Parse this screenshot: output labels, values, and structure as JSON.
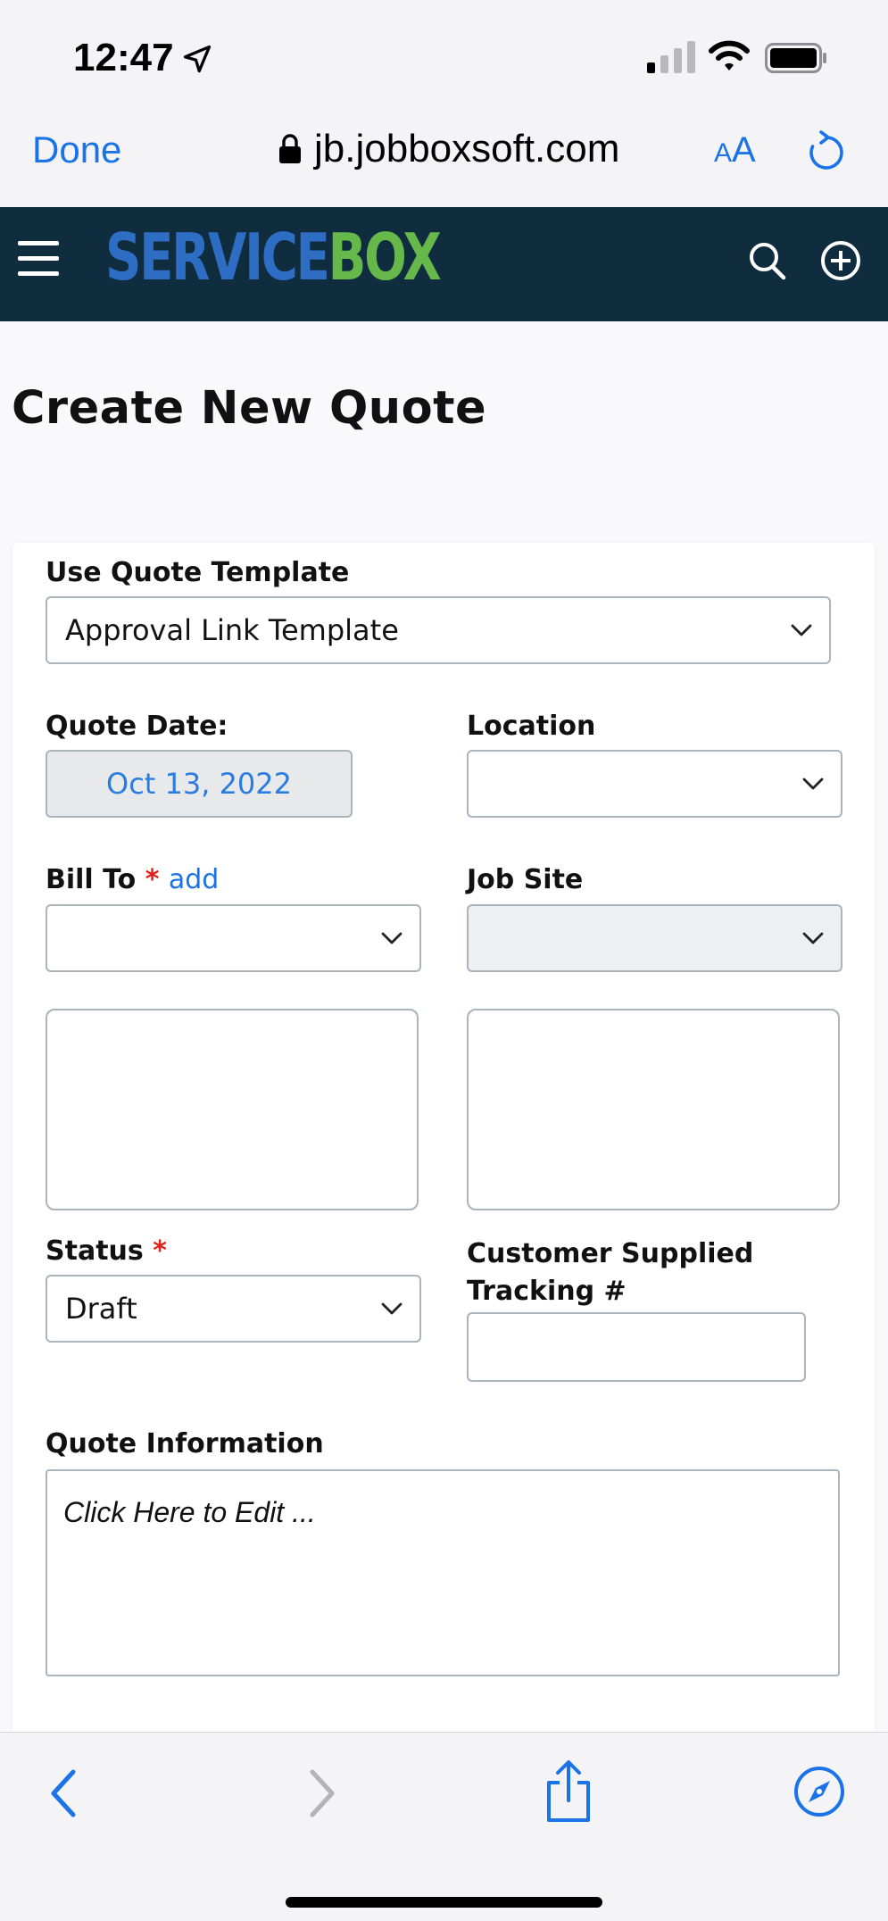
{
  "status_bar": {
    "time": "12:47"
  },
  "browser": {
    "done_label": "Done",
    "url": "jb.jobboxsoft.com",
    "text_size_small": "A",
    "text_size_large": "A"
  },
  "app_header": {
    "logo_part1": "SERVICE",
    "logo_part2": "BOX",
    "logo_colors": {
      "service": "#2d6ec4",
      "box": "#66b84a"
    },
    "background": "#0f2d3f"
  },
  "page": {
    "title": "Create New Quote"
  },
  "form": {
    "template_label": "Use Quote Template",
    "template_value": "Approval Link Template",
    "quote_date_label": "Quote Date:",
    "quote_date_value": "Oct 13, 2022",
    "location_label": "Location",
    "location_value": "",
    "bill_to_label": "Bill To",
    "required_mark": "*",
    "bill_to_add": "add",
    "bill_to_value": "",
    "job_site_label": "Job Site",
    "job_site_value": "",
    "status_label": "Status",
    "status_value": "Draft",
    "tracking_label_line1": "Customer Supplied",
    "tracking_label_line2": "Tracking #",
    "tracking_value": "",
    "quote_info_label": "Quote Information",
    "quote_info_placeholder": "Click Here to Edit ..."
  },
  "icons": {
    "location": "location-arrow-icon",
    "lock": "lock-icon",
    "reload": "reload-icon",
    "menu": "hamburger-icon",
    "search": "search-icon",
    "add": "plus-circle-icon",
    "back": "chevron-left-icon",
    "forward": "chevron-right-icon",
    "share": "share-icon",
    "compass": "compass-icon"
  },
  "accent_color": "#1a73e8"
}
